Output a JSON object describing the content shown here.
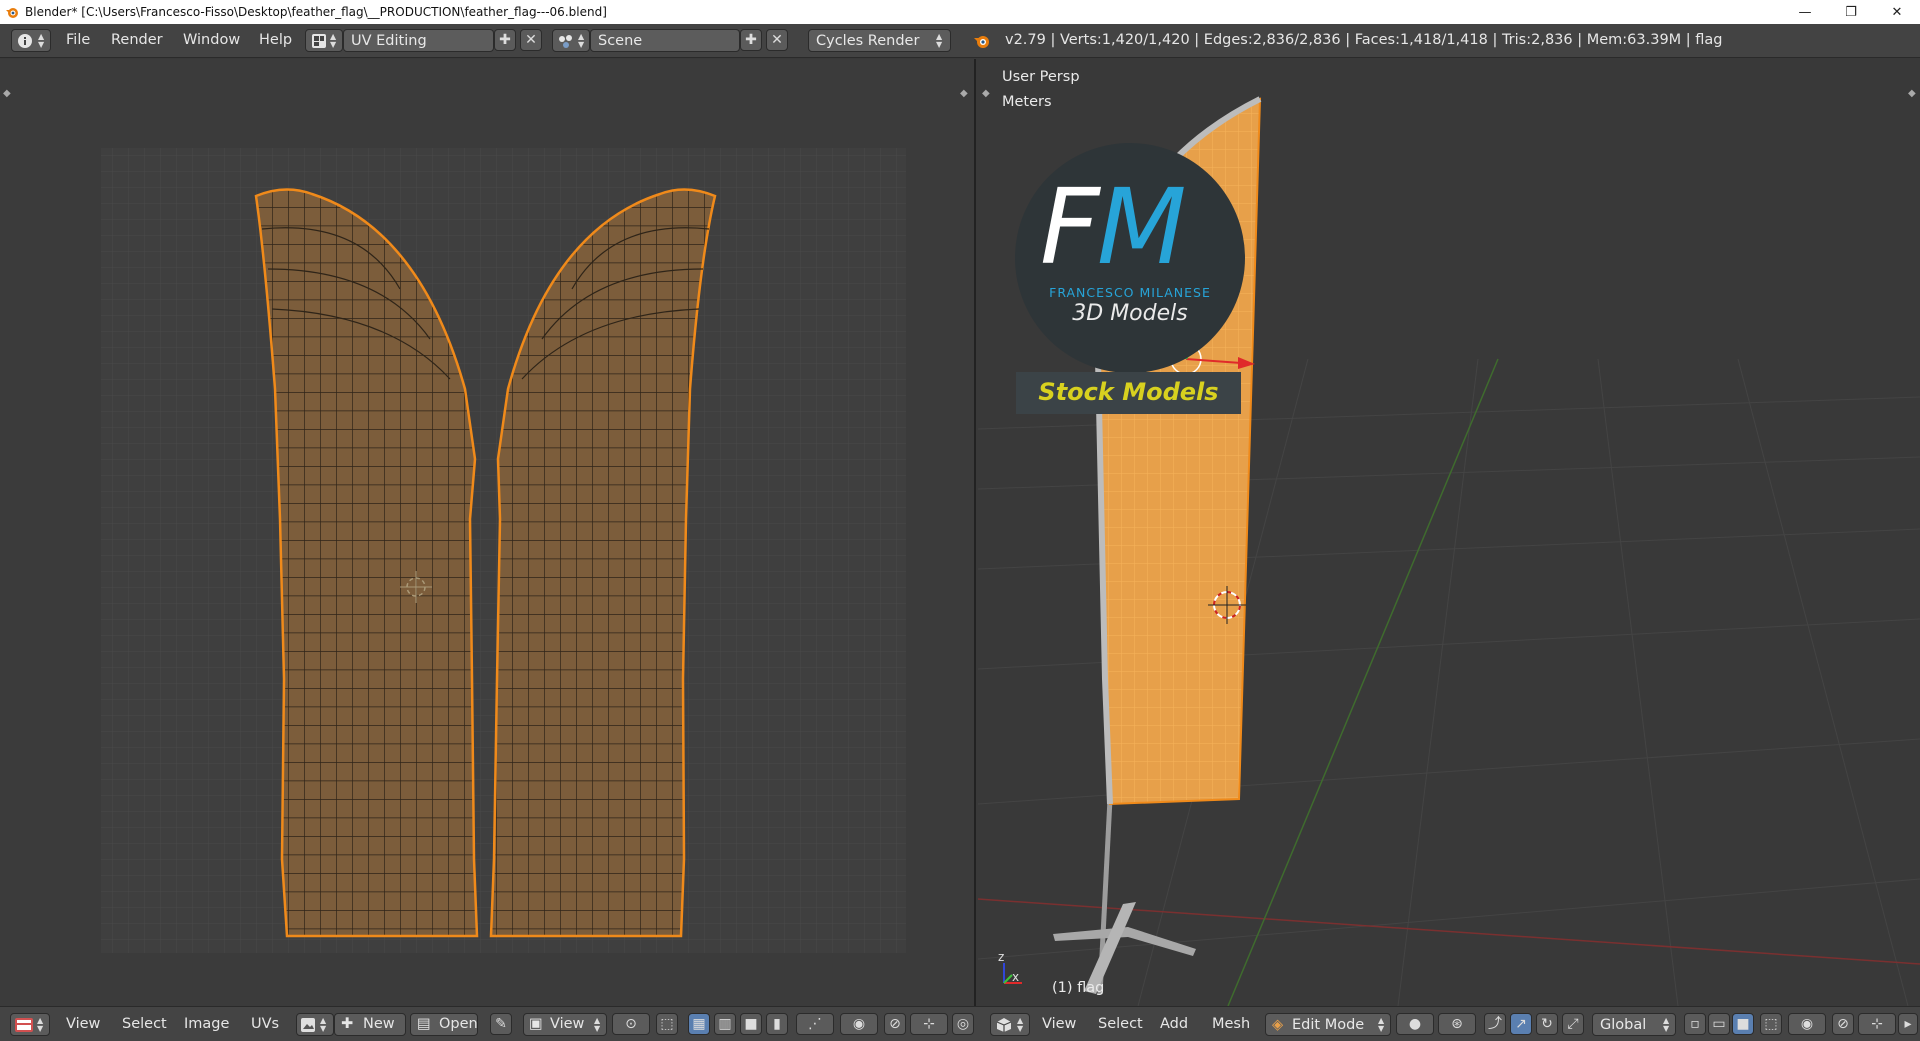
{
  "window": {
    "title": "Blender* [C:\\Users\\Francesco-Fisso\\Desktop\\feather_flag\\__PRODUCTION\\feather_flag---06.blend]",
    "minimize_glyph": "—",
    "restore_glyph": "❐",
    "close_glyph": "✕"
  },
  "info_header": {
    "menus": [
      "File",
      "Render",
      "Window",
      "Help"
    ],
    "screen_layout": "UV Editing",
    "scene": "Scene",
    "render_engine": "Cycles Render",
    "stats": "v2.79 | Verts:1,420/1,420 | Edges:2,836/2,836 | Faces:1,418/1,418 | Tris:2,836 | Mem:63.39M | flag"
  },
  "uv_editor": {
    "footer": {
      "menus": [
        "View",
        "Select",
        "Image",
        "UVs"
      ],
      "new_label": "New",
      "open_label": "Open",
      "view_label": "View"
    }
  },
  "viewport": {
    "view_label": "User Persp",
    "units_label": "Meters",
    "object_label": "(1) flag",
    "axis_x": "x",
    "axis_z": "z",
    "logo": {
      "monogram_f": "F",
      "monogram_m": "M",
      "name": "FRANCESCO MILANESE",
      "subtitle": "3D Models",
      "stock_label": "Stock Models"
    },
    "footer": {
      "menus": [
        "View",
        "Select",
        "Add",
        "Mesh"
      ],
      "mode": "Edit Mode",
      "orientation": "Global"
    }
  },
  "colors": {
    "accent_orange": "#f08a1a",
    "uv_fill": "#7c5d3b",
    "flag_fill": "#e7a04a",
    "logo_blue": "#27a4d8",
    "stock_yellow": "#d8d11f"
  }
}
